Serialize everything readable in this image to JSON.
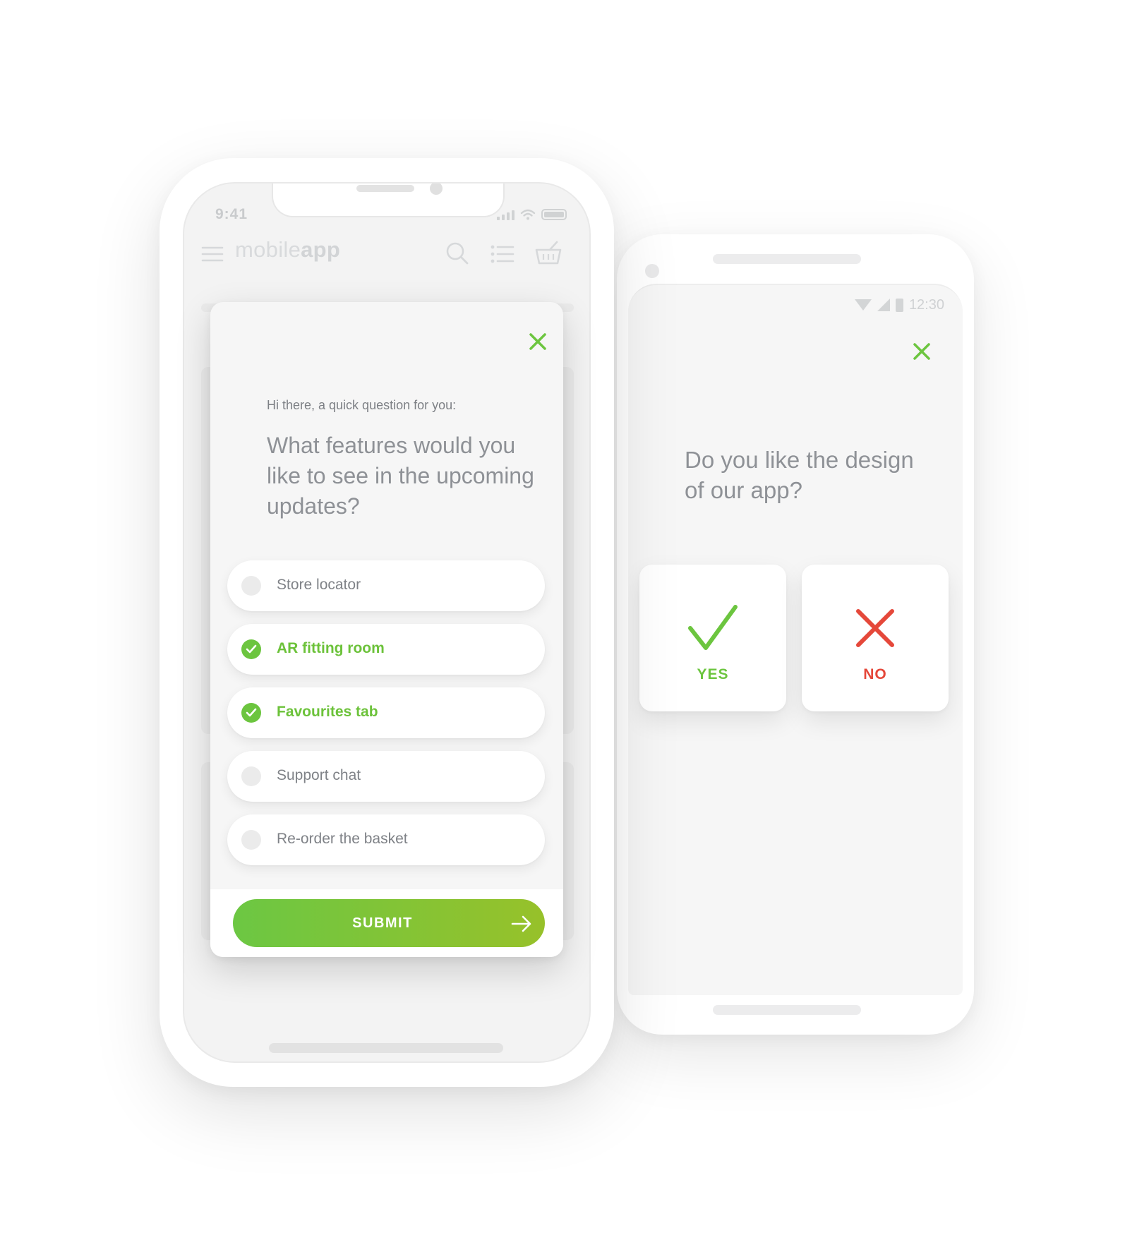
{
  "android": {
    "status_time": "12:30",
    "question": "Do you like the design of our app?",
    "yes_label": "YES",
    "no_label": "NO",
    "close_icon": "close-icon"
  },
  "iphone": {
    "status_time": "9:41",
    "app_logo": {
      "part1": "mobile",
      "part2": "app"
    },
    "survey": {
      "greeting": "Hi there, a quick question for you:",
      "question": "What features would you like to see in the upcoming updates?",
      "options": [
        {
          "label": "Store locator",
          "checked": false
        },
        {
          "label": "AR fitting room",
          "checked": true
        },
        {
          "label": "Favourites tab",
          "checked": true
        },
        {
          "label": "Support chat",
          "checked": false
        },
        {
          "label": "Re-order the basket",
          "checked": false
        }
      ],
      "submit_label": "SUBMIT"
    }
  },
  "colors": {
    "accent_green": "#6cc53f",
    "gradient_end": "#97c12a",
    "negative_red": "#e5483a",
    "muted_text": "#8e9196"
  }
}
